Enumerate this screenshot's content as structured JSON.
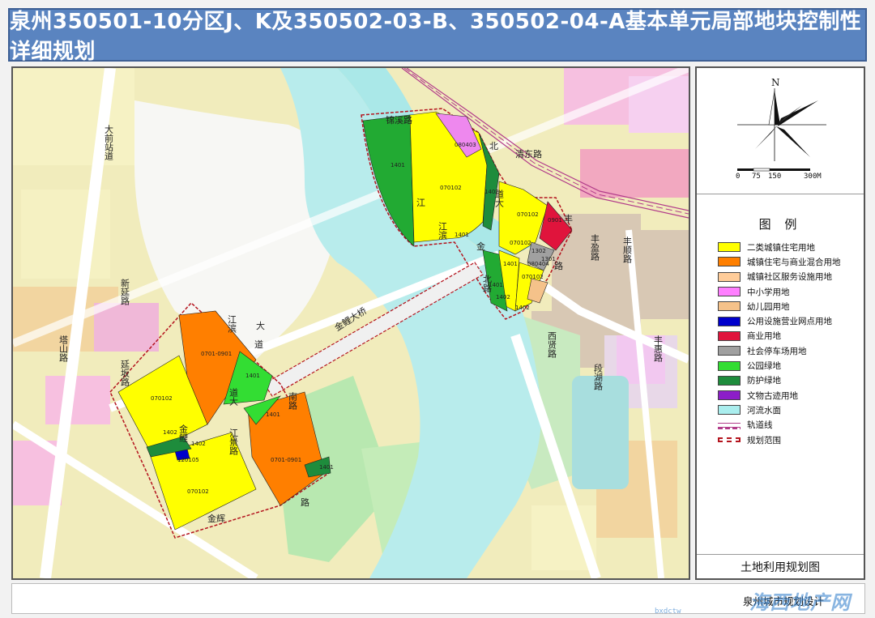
{
  "title": "泉州350501-10分区J、K及350502-03-B、350502-04-A基本单元局部地块控制性详细规划",
  "compass": {
    "north_label": "N",
    "scale_ticks": [
      "0",
      "75",
      "150",
      "300M"
    ]
  },
  "legend": {
    "title": "图 例",
    "items": [
      {
        "label": "二类城镇住宅用地",
        "color": "#ffff00",
        "kind": "fill"
      },
      {
        "label": "城镇住宅与商业混合用地",
        "color": "#ff7f00",
        "kind": "fill"
      },
      {
        "label": "城镇社区服务设施用地",
        "color": "#ffcc99",
        "kind": "fill"
      },
      {
        "label": "中小学用地",
        "color": "#ff7fff",
        "kind": "fill"
      },
      {
        "label": "幼儿园用地",
        "color": "#f5c28a",
        "kind": "fill"
      },
      {
        "label": "公用设施营业网点用地",
        "color": "#0000cc",
        "kind": "fill"
      },
      {
        "label": "商业用地",
        "color": "#e0143c",
        "kind": "fill"
      },
      {
        "label": "社会停车场用地",
        "color": "#a0a0a0",
        "kind": "fill"
      },
      {
        "label": "公园绿地",
        "color": "#33dd33",
        "kind": "fill"
      },
      {
        "label": "防护绿地",
        "color": "#1e8c3c",
        "kind": "fill"
      },
      {
        "label": "文物古迹用地",
        "color": "#8c1ec8",
        "kind": "fill"
      },
      {
        "label": "河流水面",
        "color": "#aaeeee",
        "kind": "fill"
      },
      {
        "label": "轨道线",
        "color": "#b23c8a",
        "kind": "rail"
      },
      {
        "label": "规划范围",
        "color": "#b4141e",
        "kind": "boundary"
      }
    ]
  },
  "map_name": "土地利用规划图",
  "footer": {
    "org": "泉州城市规划设计",
    "watermark": "海西地产网",
    "watermark_url": "bxdctw"
  },
  "map": {
    "roads": {
      "dao_qian": "大前站道",
      "xin_yan": "新延路",
      "ta_shan": "塔山路",
      "po_yan": "延坂路",
      "jin_xi": "锦溪路",
      "qing_dong": "清东路",
      "beiqing_north": "北",
      "dao_da": "道大",
      "jiang_bin": "江滨",
      "jin": "金",
      "bei_lu": "北路",
      "jin_li": "金鲤大桥",
      "jiang_bin_nan": "江滨",
      "da_dao": "道大",
      "nan_lu": "南路",
      "li_jin": "金鲤",
      "jiang_jing": "江景路",
      "jin_hui": "金辉",
      "lu_small": "路",
      "xi_xian": "西贤路",
      "feng_ying": "丰盈路",
      "feng_shun": "丰顺路",
      "feng_hui": "丰惠路",
      "duan_hu": "段湖路",
      "road_feng": "丰",
      "road_lu": "路",
      "road_jiang": "江",
      "road_dao": "道",
      "road_da": "大"
    },
    "codes": {
      "a": "1401",
      "b": "070102",
      "c": "080403",
      "d": "1401",
      "e": "1402",
      "f": "070102",
      "g": "0901",
      "h": "070102",
      "i": "080404",
      "j": "070102",
      "k": "1401",
      "l": "0701-0901",
      "m": "1401",
      "n": "070102",
      "o": "1402",
      "p": "0701-0901",
      "q": "1401",
      "r": "070102",
      "s": "1402",
      "t": "1302",
      "u": "1301",
      "v": "120105",
      "w": "1401",
      "x": "1402",
      "y": "1401",
      "z": "1402"
    }
  }
}
